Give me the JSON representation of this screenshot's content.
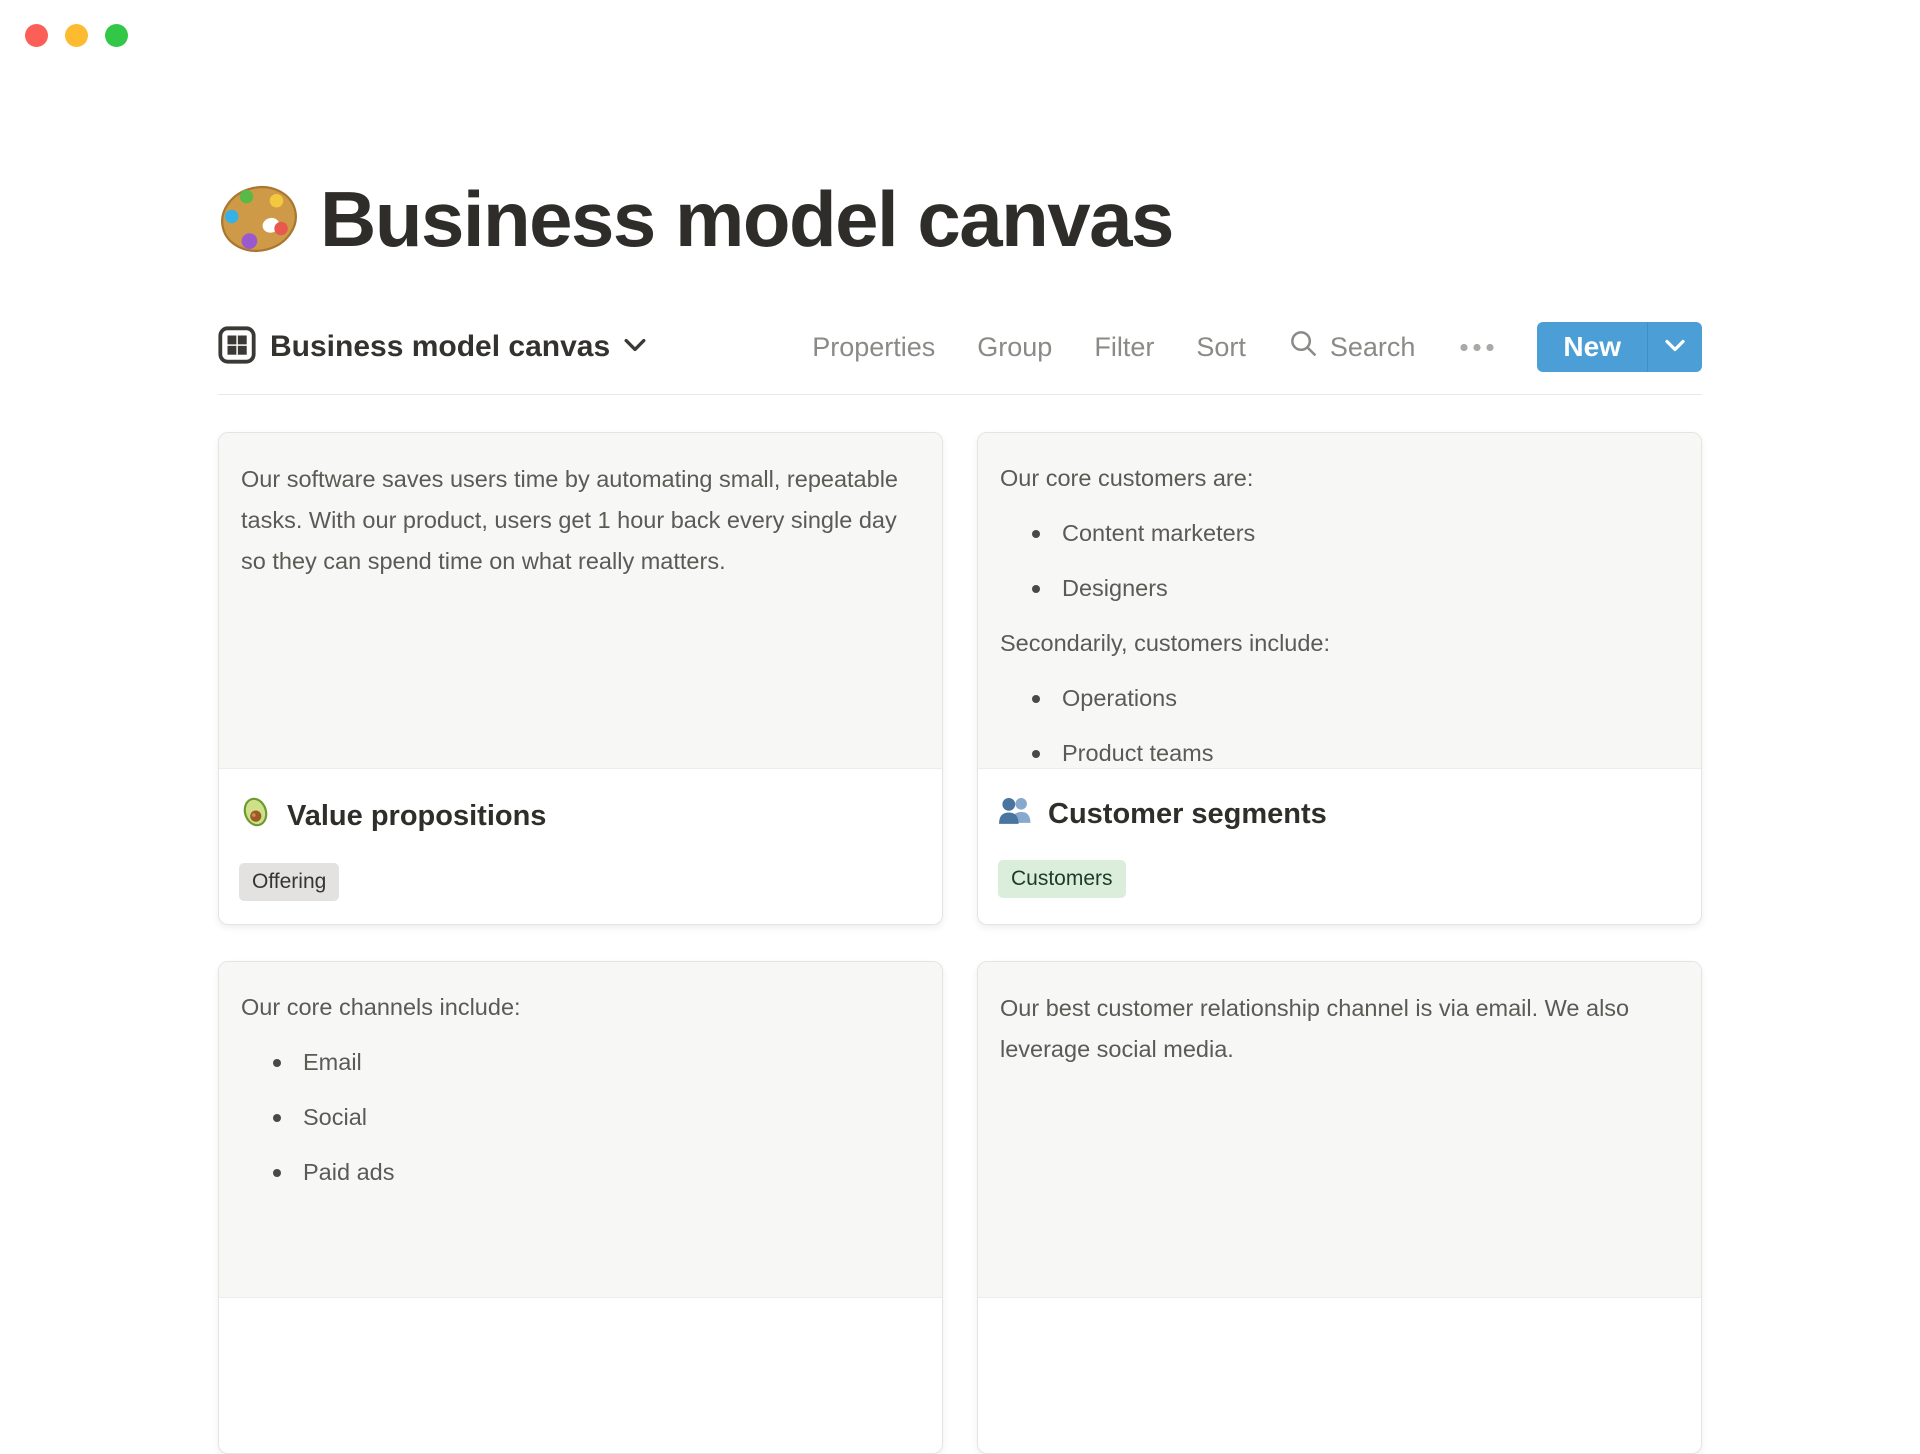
{
  "window": {
    "controls": [
      {
        "name": "close",
        "color": "#fc5f57"
      },
      {
        "name": "minimize",
        "color": "#fdbc2f"
      },
      {
        "name": "zoom",
        "color": "#33c748"
      }
    ]
  },
  "page": {
    "icon": "palette-icon",
    "title": "Business model canvas"
  },
  "view_bar": {
    "view_switcher": {
      "icon": "board-view-icon",
      "label": "Business model canvas",
      "chevron": "chevron-down-icon"
    },
    "menu": {
      "properties": "Properties",
      "group": "Group",
      "filter": "Filter",
      "sort": "Sort",
      "search": "Search",
      "search_icon": "search-icon",
      "more_icon": "ellipsis-icon"
    },
    "new_button": {
      "label": "New",
      "chevron": "chevron-down-icon",
      "color": "#4b9fd6"
    }
  },
  "cards": [
    {
      "preview": {
        "text": "Our software saves users time by automating small, repeatable tasks. With our product, users get 1 hour back every single day so they can spend time on what really matters."
      },
      "icon": "avocado-icon",
      "title": "Value propositions",
      "tag": {
        "label": "Offering",
        "bg": "#e3e2e0",
        "color": "#37352f"
      }
    },
    {
      "preview": {
        "blocks": [
          {
            "type": "paragraph",
            "text": "Our core customers are:"
          },
          {
            "type": "bullet",
            "text": "Content marketers"
          },
          {
            "type": "bullet",
            "text": "Designers"
          },
          {
            "type": "paragraph",
            "text": "Secondarily, customers include:"
          },
          {
            "type": "bullet",
            "text": "Operations"
          },
          {
            "type": "bullet",
            "text": "Product teams"
          }
        ]
      },
      "icon": "people-icon",
      "title": "Customer segments",
      "tag": {
        "label": "Customers",
        "bg": "#dbeddb",
        "color": "#1d3b2a"
      }
    },
    {
      "preview": {
        "blocks": [
          {
            "type": "paragraph",
            "text": "Our core channels include:"
          },
          {
            "type": "bullet",
            "text": "Email"
          },
          {
            "type": "bullet",
            "text": "Social"
          },
          {
            "type": "bullet",
            "text": "Paid ads"
          }
        ]
      }
    },
    {
      "preview": {
        "text": "Our best customer relationship channel is via email. We also leverage social media."
      }
    }
  ],
  "colors": {
    "accent_blue": "#4b9fd6",
    "accent_blue_divider": "#3c92c8",
    "preview_bg": "#f7f7f5",
    "card_border": "#e6e4e1",
    "toolbar_text": "#8a8a86",
    "body_text": "#5b5a55",
    "heading_text": "#2e2d29",
    "divider": "#e9e9e7",
    "tag_gray_bg": "#e3e2e0",
    "tag_green_bg": "#dbeddb"
  }
}
